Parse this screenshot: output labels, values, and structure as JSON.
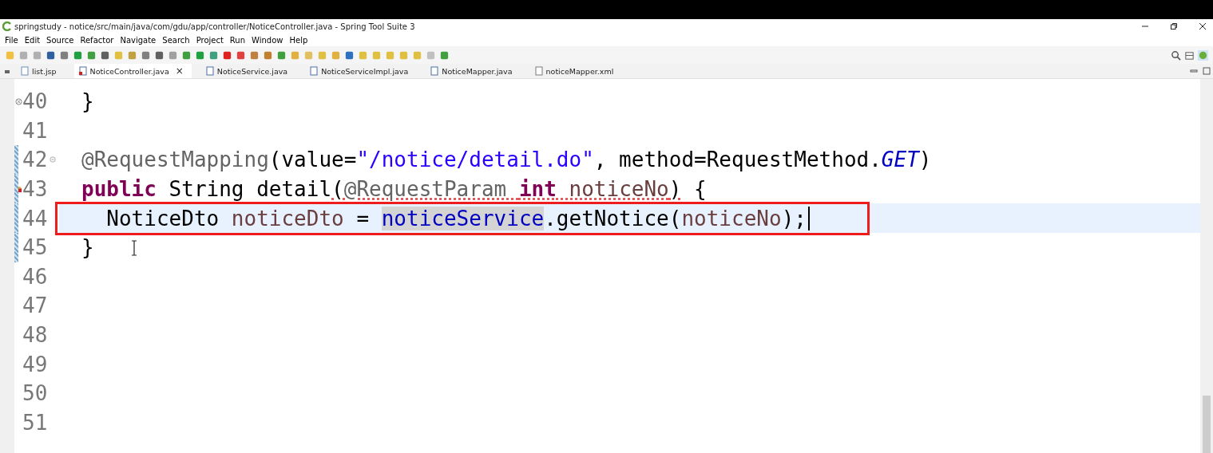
{
  "window": {
    "title": "springstudy - notice/src/main/java/com/gdu/app/controller/NoticeController.java - Spring Tool Suite 3"
  },
  "menu": [
    "File",
    "Edit",
    "Source",
    "Refactor",
    "Navigate",
    "Search",
    "Project",
    "Run",
    "Window",
    "Help"
  ],
  "tabs": [
    {
      "label": "list.jsp",
      "kind": "jsp",
      "selected": false
    },
    {
      "label": "NoticeController.java",
      "kind": "java-error",
      "selected": true
    },
    {
      "label": "NoticeService.java",
      "kind": "java",
      "selected": false
    },
    {
      "label": "NoticeServiceImpl.java",
      "kind": "java",
      "selected": false
    },
    {
      "label": "NoticeMapper.java",
      "kind": "java",
      "selected": false
    },
    {
      "label": "noticeMapper.xml",
      "kind": "xml",
      "selected": false
    }
  ],
  "tab_close": "×",
  "editor": {
    "lines": [
      {
        "number": "40",
        "collapsed": true,
        "tokens": [
          {
            "text": "}",
            "kind": "plain"
          }
        ]
      },
      {
        "number": "41"
      },
      {
        "number": "42",
        "foldable": true,
        "changed": true,
        "tokens": [
          {
            "text": "@RequestMapping",
            "kind": "annotation"
          },
          {
            "text": "(value=",
            "kind": "plain"
          },
          {
            "text": "\"/notice/detail.do\"",
            "kind": "string"
          },
          {
            "text": ", method=RequestMethod.",
            "kind": "plain"
          },
          {
            "text": "GET",
            "kind": "constant"
          },
          {
            "text": ")",
            "kind": "plain"
          }
        ]
      },
      {
        "number": "43",
        "problem": true,
        "changed": true,
        "tokens": [
          {
            "text": "public",
            "kind": "keyword"
          },
          {
            "text": " String detail",
            "kind": "plain"
          },
          {
            "text": "(",
            "kind": "plain",
            "squiggle": true
          },
          {
            "text": "@RequestParam ",
            "kind": "annotation",
            "squiggle": true
          },
          {
            "text": "int",
            "kind": "keyword",
            "squiggle": true
          },
          {
            "text": " noticeNo",
            "kind": "local",
            "squiggle": true
          },
          {
            "text": ")",
            "kind": "plain",
            "squiggle": true
          },
          {
            "text": " {",
            "kind": "plain"
          }
        ]
      },
      {
        "number": "44",
        "changed": true,
        "current": true,
        "boxed": true,
        "caret": true,
        "tokens": [
          {
            "text": "  NoticeDto ",
            "kind": "plain"
          },
          {
            "text": "noticeDto",
            "kind": "local"
          },
          {
            "text": " = ",
            "kind": "plain"
          },
          {
            "text": "noticeService",
            "kind": "field",
            "occurrence": true
          },
          {
            "text": ".getNotice(",
            "kind": "plain"
          },
          {
            "text": "noticeNo",
            "kind": "local"
          },
          {
            "text": ");",
            "kind": "plain"
          }
        ]
      },
      {
        "number": "45",
        "changed": true,
        "tokens": [
          {
            "text": "}",
            "kind": "plain"
          }
        ]
      },
      {
        "number": "46"
      },
      {
        "number": "47"
      },
      {
        "number": "48"
      },
      {
        "number": "49"
      },
      {
        "number": "50"
      },
      {
        "number": "51"
      }
    ]
  }
}
